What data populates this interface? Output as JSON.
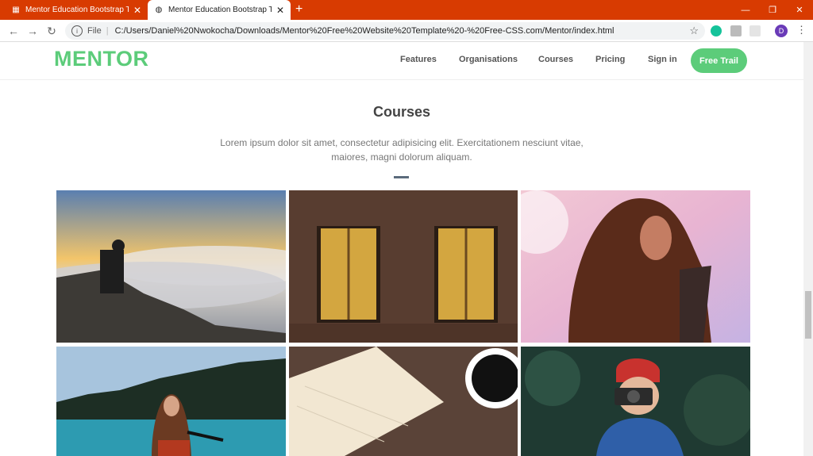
{
  "browser": {
    "tabs": [
      {
        "title": "Mentor Education Bootstrap The",
        "active": false
      },
      {
        "title": "Mentor Education Bootstrap The",
        "active": true
      }
    ],
    "new_tab_glyph": "+",
    "address": {
      "file_label": "File",
      "url": "C:/Users/Daniel%20Nwokocha/Downloads/Mentor%20Free%20Website%20Template%20-%20Free-CSS.com/Mentor/index.html"
    },
    "profile_initial": "D",
    "colors": {
      "tabbar": "#d83b01"
    }
  },
  "site": {
    "logo": "MENTOR",
    "nav": [
      "Features",
      "Organisations",
      "Courses",
      "Pricing",
      "Sign in"
    ],
    "cta": "Free Trail",
    "colors": {
      "accent": "#5ccc7a"
    }
  },
  "courses": {
    "title": "Courses",
    "description": "Lorem ipsum dolor sit amet, consectetur adipisicing elit. Exercitationem nesciunt vitae, maiores, magni dolorum aliquam.",
    "images": [
      {
        "name": "man-above-clouds-photo"
      },
      {
        "name": "brick-wall-windows-photo"
      },
      {
        "name": "woman-sunlight-photo"
      },
      {
        "name": "lake-canoe-photo"
      },
      {
        "name": "notebook-coffee-photo"
      },
      {
        "name": "woman-camera-photo"
      }
    ]
  }
}
